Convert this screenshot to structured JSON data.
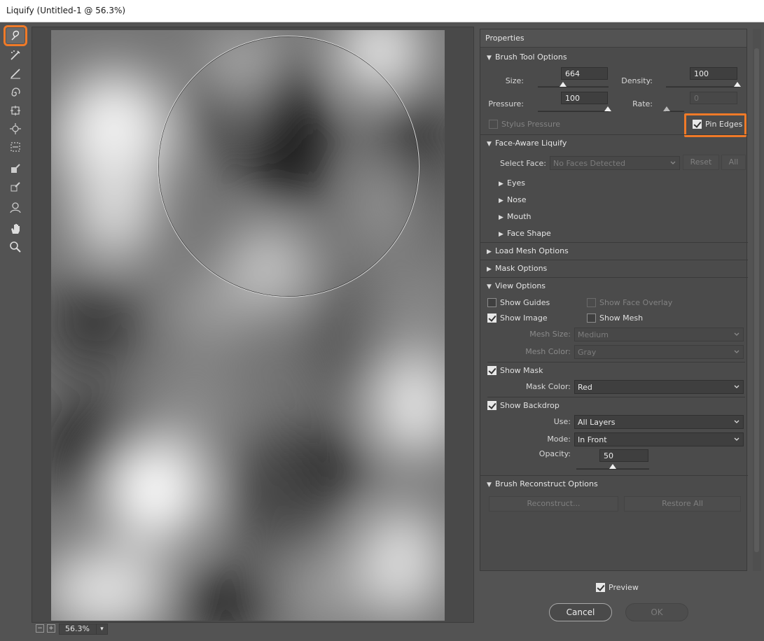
{
  "window": {
    "title": "Liquify (Untitled-1 @ 56.3%)"
  },
  "tools": [
    {
      "name": "forward-warp-tool-icon",
      "active": true
    },
    {
      "name": "reconstruct-tool-icon"
    },
    {
      "name": "smooth-tool-icon"
    },
    {
      "name": "twirl-clockwise-tool-icon"
    },
    {
      "name": "pucker-tool-icon"
    },
    {
      "name": "bloat-tool-icon"
    },
    {
      "name": "push-left-tool-icon"
    },
    {
      "name": "freeze-mask-tool-icon"
    },
    {
      "name": "thaw-mask-tool-icon"
    },
    {
      "name": "face-tool-icon"
    },
    {
      "name": "hand-tool-icon"
    },
    {
      "name": "zoom-tool-icon"
    }
  ],
  "status": {
    "zoom": "56.3%",
    "zoom_out": "−",
    "zoom_in": "+"
  },
  "properties": {
    "title": "Properties",
    "brush_tool_options": {
      "heading": "Brush Tool Options",
      "size_label": "Size:",
      "size_value": "664",
      "size_slider": 0.37,
      "density_label": "Density:",
      "density_value": "100",
      "density_slider": 1.0,
      "pressure_label": "Pressure:",
      "pressure_value": "100",
      "pressure_slider": 1.0,
      "rate_label": "Rate:",
      "rate_value": "0",
      "rate_slider": 0.0,
      "stylus_pressure": "Stylus Pressure",
      "pin_edges": "Pin Edges"
    },
    "face_aware": {
      "heading": "Face-Aware Liquify",
      "select_face_label": "Select Face:",
      "select_face_value": "No Faces Detected",
      "reset": "Reset",
      "all": "All",
      "items": [
        "Eyes",
        "Nose",
        "Mouth",
        "Face Shape"
      ]
    },
    "load_mesh": {
      "heading": "Load Mesh Options"
    },
    "mask_options": {
      "heading": "Mask Options"
    },
    "view_options": {
      "heading": "View Options",
      "show_guides": "Show Guides",
      "show_face_overlay": "Show Face Overlay",
      "show_image": "Show Image",
      "show_mesh": "Show Mesh",
      "mesh_size_label": "Mesh Size:",
      "mesh_size_value": "Medium",
      "mesh_color_label": "Mesh Color:",
      "mesh_color_value": "Gray",
      "show_mask": "Show Mask",
      "mask_color_label": "Mask Color:",
      "mask_color_value": "Red",
      "show_backdrop": "Show Backdrop",
      "use_label": "Use:",
      "use_value": "All Layers",
      "mode_label": "Mode:",
      "mode_value": "In Front",
      "opacity_label": "Opacity:",
      "opacity_value": "50",
      "opacity_slider": 0.5
    },
    "brush_reconstruct": {
      "heading": "Brush Reconstruct Options",
      "reconstruct": "Reconstruct...",
      "restore_all": "Restore All"
    }
  },
  "footer": {
    "preview": "Preview",
    "cancel": "Cancel",
    "ok": "OK"
  },
  "colors": {
    "highlight": "#f07a28",
    "panel": "#4b4b4b",
    "background": "#535353"
  }
}
